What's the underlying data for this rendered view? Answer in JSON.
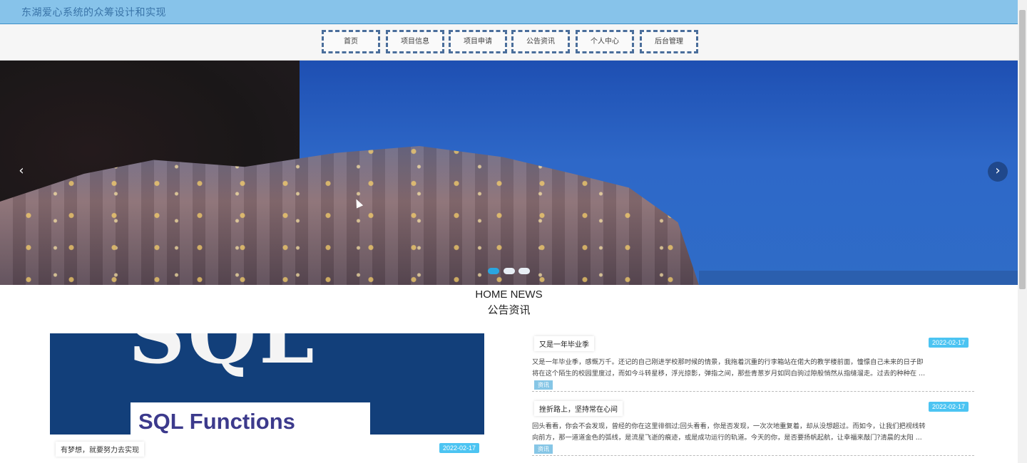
{
  "header": {
    "title": "东湖爱心系统的众筹设计和实现"
  },
  "nav": {
    "items": [
      "首页",
      "项目信息",
      "项目申请",
      "公告资讯",
      "个人中心",
      "后台管理"
    ]
  },
  "banner": {
    "prev_icon": "chevron-left-icon",
    "next_icon": "chevron-right-icon",
    "prev_glyph": "‹",
    "next_glyph": "›",
    "slide_count": 3,
    "active_slide": 1
  },
  "news_section": {
    "title_en": "HOME NEWS",
    "title_cn": "公告资讯"
  },
  "featured": {
    "image_text": "SQL Functions",
    "image_big_text": "SQL",
    "title": "有梦想，就要努力去实现",
    "date": "2022-02-17"
  },
  "news": [
    {
      "title": "又是一年毕业季",
      "date": "2022-02-17",
      "line1": "又是一年毕业季，感慨万千。还记的自己刚进学校那时候的情景，我拖着沉重的行李箱站在偌大的教学楼前面，憧憬自己未来的日子即",
      "line2": "将在这个陌生的校园里度过，而如今斗转星移，浮光掠影，弹指之间，那些青葱岁月如同白驹过隙般悄然从指缝溜走。过去的种种在 ...",
      "tag": "资讯"
    },
    {
      "title": "挫折路上，坚持常在心间",
      "date": "2022-02-17",
      "line1": "回头看看，你会不会发现，曾经的你在这里徘徊过;回头看看，你是否发现，一次次地重复着，却从没想超过。而如今，让我们把视线转",
      "line2": "向前方，那一道道金色的弧线，是流星飞逝的痕迹，或是成功运行的轨道。今天的你，是否要扬帆起航，让幸福来敲门?清晨的太阳 ...",
      "tag": "资讯"
    }
  ],
  "colors": {
    "header_bg": "#87c3ea",
    "nav_border": "#4a6e9b",
    "date_badge": "#4cc4f2",
    "tag_bg": "#86c6e6",
    "dot_active": "#2aa6e0"
  }
}
